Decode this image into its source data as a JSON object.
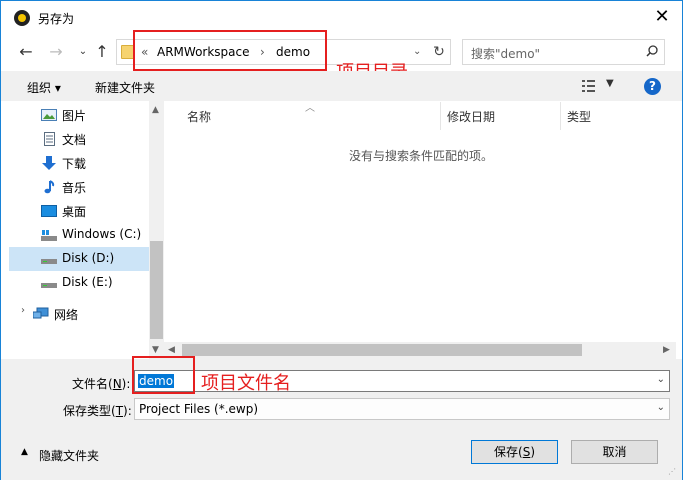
{
  "window": {
    "title": "另存为"
  },
  "address": {
    "prefix": "«",
    "crumb1": "ARMWorkspace",
    "sep": "›",
    "crumb2": "demo"
  },
  "search": {
    "placeholder": "搜索\"demo\""
  },
  "annotations": {
    "dir_note": "项目目录",
    "file_note": "项目文件名"
  },
  "toolbar": {
    "organize": "组织 ▾",
    "new_folder": "新建文件夹"
  },
  "sidebar": {
    "items": [
      {
        "label": "图片"
      },
      {
        "label": "文档"
      },
      {
        "label": "下载"
      },
      {
        "label": "音乐"
      },
      {
        "label": "桌面"
      },
      {
        "label": "Windows (C:)"
      },
      {
        "label": "Disk (D:)"
      },
      {
        "label": "Disk (E:)"
      },
      {
        "label": "网络"
      }
    ]
  },
  "list": {
    "col_name": "名称",
    "col_date": "修改日期",
    "col_type": "类型",
    "empty_message": "没有与搜索条件匹配的项。"
  },
  "form": {
    "filename_label": "文件名(",
    "filename_key": "N",
    "filename_label_end": "):",
    "filename_value": "demo",
    "filetype_label": "保存类型(",
    "filetype_key": "T",
    "filetype_label_end": "):",
    "filetype_value": "Project Files (*.ewp)"
  },
  "footer": {
    "hide_folders": "隐藏文件夹",
    "save_label": "保存(",
    "save_key": "S",
    "save_end": ")",
    "cancel_label": "取消"
  },
  "colors": {
    "accent": "#0078d7",
    "annotation_red": "#e51f1f",
    "selection": "#cce4f7"
  }
}
